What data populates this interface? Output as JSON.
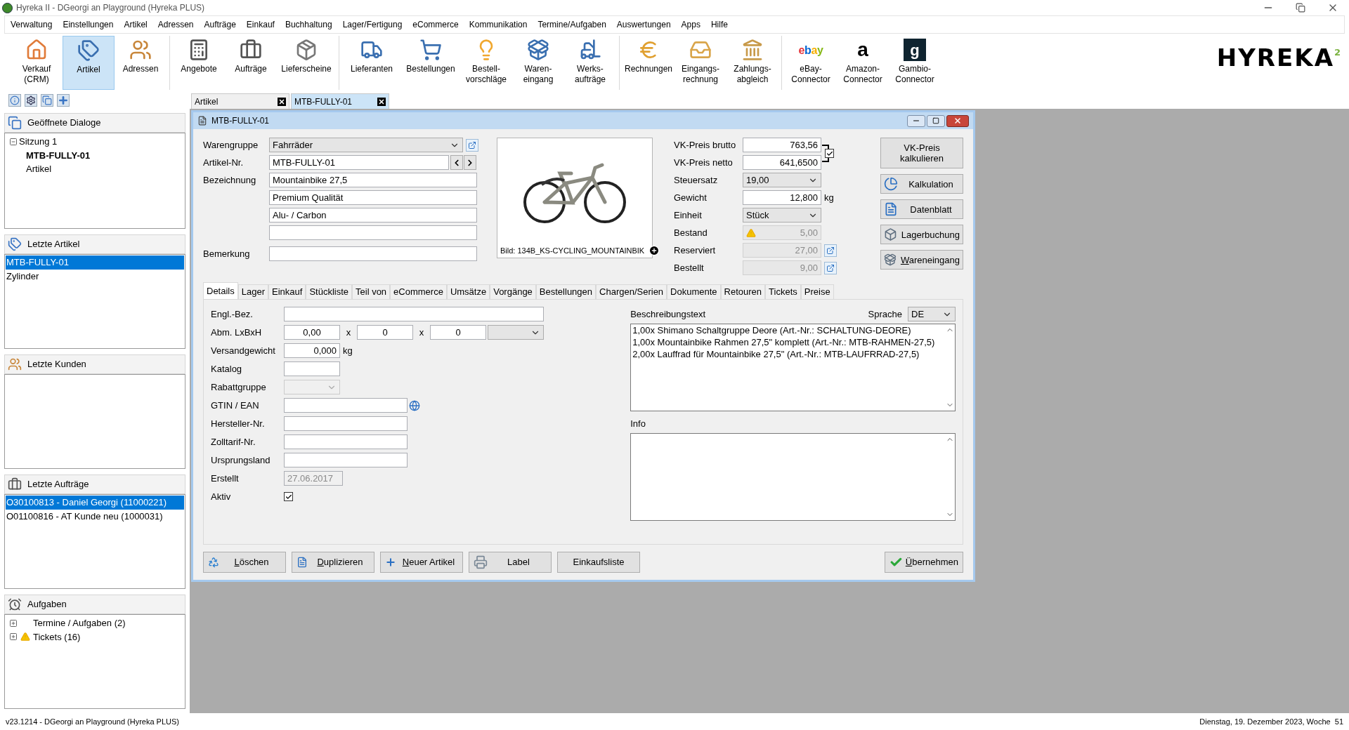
{
  "window": {
    "title": "Hyreka II - DGeorgi an Playground (Hyreka PLUS)"
  },
  "menu": [
    "Verwaltung",
    "Einstellungen",
    "Artikel",
    "Adressen",
    "Aufträge",
    "Einkauf",
    "Buchhaltung",
    "Lager/Fertigung",
    "eCommerce",
    "Kommunikation",
    "Termine/Aufgaben",
    "Auswertungen",
    "Apps",
    "Hilfe"
  ],
  "toolbar": {
    "groups": [
      {
        "items": [
          {
            "kind": "house",
            "lines": [
              "Verkauf",
              "(CRM)"
            ],
            "selected": false
          },
          {
            "kind": "tags",
            "lines": [
              "Artikel"
            ],
            "selected": true
          },
          {
            "kind": "people",
            "lines": [
              "Adressen"
            ],
            "selected": false
          }
        ]
      },
      {
        "items": [
          {
            "kind": "calculator",
            "lines": [
              "Angebote"
            ],
            "selected": false
          },
          {
            "kind": "briefcase",
            "lines": [
              "Aufträge"
            ],
            "selected": false
          },
          {
            "kind": "package",
            "lines": [
              "Lieferscheine"
            ],
            "selected": false
          }
        ]
      },
      {
        "items": [
          {
            "kind": "truck",
            "lines": [
              "Lieferanten"
            ],
            "selected": false
          },
          {
            "kind": "cart",
            "lines": [
              "Bestellungen"
            ],
            "selected": false
          },
          {
            "kind": "bulb",
            "lines": [
              "Bestell-",
              "vorschläge"
            ],
            "selected": false
          },
          {
            "kind": "box-in",
            "lines": [
              "Waren-",
              "eingang"
            ],
            "selected": false
          },
          {
            "kind": "forklift",
            "lines": [
              "Werks-",
              "aufträge"
            ],
            "selected": false
          }
        ]
      },
      {
        "items": [
          {
            "kind": "euro",
            "lines": [
              "Rechnungen"
            ],
            "selected": false
          },
          {
            "kind": "inbox",
            "lines": [
              "Eingangs-",
              "rechnung"
            ],
            "selected": false
          },
          {
            "kind": "bank",
            "lines": [
              "Zahlungs-",
              "abgleich"
            ],
            "selected": false
          }
        ]
      },
      {
        "items": [
          {
            "kind": "ebay",
            "logo": "ebay",
            "lines": [
              "eBay-",
              "Connector"
            ],
            "selected": false
          },
          {
            "kind": "amazon",
            "logo": "a",
            "lines": [
              "Amazon-",
              "Connector"
            ],
            "selected": false
          },
          {
            "kind": "gambio",
            "logo": "g",
            "lines": [
              "Gambio-",
              "Connector"
            ],
            "selected": false
          }
        ]
      }
    ]
  },
  "brand": {
    "name": "HYREKA",
    "sup": "2"
  },
  "doc_tabs": [
    {
      "label": "Artikel",
      "selected": false
    },
    {
      "label": "MTB-FULLY-01",
      "selected": true
    }
  ],
  "sidebar": {
    "open_dialogs": {
      "title": "Geöffnete Dialoge",
      "tree": [
        {
          "label": "Sitzung 1",
          "expanded": true,
          "children": [
            {
              "label": "MTB-FULLY-01",
              "selected": true
            },
            {
              "label": "Artikel",
              "selected": false
            }
          ]
        }
      ]
    },
    "recent_articles": {
      "title": "Letzte Artikel",
      "items": [
        {
          "label": "MTB-FULLY-01",
          "selected": true
        },
        {
          "label": "Zylinder",
          "selected": false
        }
      ]
    },
    "recent_customers": {
      "title": "Letzte Kunden"
    },
    "recent_orders": {
      "title": "Letzte Aufträge",
      "items": [
        {
          "label": "O30100813 - Daniel Georgi (11000221)",
          "selected": true
        },
        {
          "label": "O01100816 - AT Kunde neu (1000031)",
          "selected": false
        }
      ]
    },
    "tasks": {
      "title": "Aufgaben",
      "items": [
        {
          "label": "Termine / Aufgaben (2)",
          "expanded": false,
          "warning": false
        },
        {
          "label": "Tickets (16)",
          "expanded": false,
          "warning": true
        }
      ]
    }
  },
  "dialog": {
    "title": "MTB-FULLY-01",
    "header_fields": [
      {
        "kind": "select",
        "label": "Warengruppe",
        "value": "Fahrräder"
      },
      {
        "kind": "nav",
        "label": "Artikel-Nr.",
        "value": "MTB-FULLY-01"
      },
      {
        "kind": "text",
        "label": "Bezeichnung",
        "value": "Mountainbike 27,5"
      },
      {
        "kind": "text",
        "value": "Premium Qualität"
      },
      {
        "kind": "text",
        "value": "Alu- / Carbon"
      },
      {
        "kind": "text"
      },
      {
        "kind": "text",
        "label": "Bemerkung"
      }
    ],
    "image_caption": "Bild: 134B_KS-CYCLING_MOUNTAINBIK",
    "price_link_checked": true,
    "price_fields": [
      {
        "kind": "input",
        "label": "VK-Preis brutto",
        "value": "763,56"
      },
      {
        "kind": "input",
        "label": "VK-Preis netto",
        "value": "641,6500"
      },
      {
        "kind": "select",
        "label": "Steuersatz",
        "value": "19,00"
      },
      {
        "kind": "input",
        "label": "Gewicht",
        "value": "12,800",
        "unit": "kg"
      },
      {
        "kind": "select",
        "label": "Einheit",
        "value": "Stück"
      },
      {
        "kind": "readonly",
        "label": "Bestand",
        "value": "5,00",
        "warning": true
      },
      {
        "kind": "readonly",
        "label": "Reserviert",
        "value": "27,00",
        "link": true
      },
      {
        "kind": "readonly",
        "label": "Bestellt",
        "value": "9,00",
        "link": true
      }
    ],
    "side_buttons": [
      {
        "kind": "plain",
        "label": "VK-Preis kalkulieren"
      },
      {
        "kind": "pie",
        "label": "Kalkulation"
      },
      {
        "kind": "sheet",
        "label": "Datenblatt"
      },
      {
        "kind": "box",
        "label": "Lagerbuchung"
      },
      {
        "kind": "box-in",
        "label": "Wareneingang",
        "accelerator": true
      }
    ],
    "tabs": [
      {
        "label": "Details",
        "selected": true
      },
      {
        "label": "Lager",
        "selected": false
      },
      {
        "label": "Einkauf",
        "selected": false
      },
      {
        "label": "Stückliste",
        "selected": false
      },
      {
        "label": "Teil von",
        "selected": false
      },
      {
        "label": "eCommerce",
        "selected": false
      },
      {
        "label": "Umsätze",
        "selected": false
      },
      {
        "label": "Vorgänge",
        "selected": false
      },
      {
        "label": "Bestellungen",
        "selected": false
      },
      {
        "label": "Chargen/Serien",
        "selected": false
      },
      {
        "label": "Dokumente",
        "selected": false
      },
      {
        "label": "Retouren",
        "selected": false
      },
      {
        "label": "Tickets",
        "selected": false
      },
      {
        "label": "Preise",
        "selected": false
      }
    ],
    "details": [
      {
        "kind": "wide",
        "label": "Engl.-Bez."
      },
      {
        "kind": "dims",
        "label": "Abm. LxBxH",
        "values": [
          "0,00",
          "0",
          "0"
        ],
        "separators": [
          "x",
          "x"
        ]
      },
      {
        "kind": "number",
        "label": "Versandgewicht",
        "value": "0,000",
        "unit": "kg"
      },
      {
        "kind": "short",
        "label": "Katalog"
      },
      {
        "kind": "select",
        "label": "Rabattgruppe",
        "disabled": true
      },
      {
        "kind": "globe",
        "label": "GTIN / EAN"
      },
      {
        "kind": "medium",
        "label": "Hersteller-Nr."
      },
      {
        "kind": "medium",
        "label": "Zolltarif-Nr."
      },
      {
        "kind": "medium",
        "label": "Ursprungsland"
      },
      {
        "kind": "date",
        "label": "Erstellt",
        "value": "27.06.2017",
        "disabled": true
      },
      {
        "kind": "check",
        "label": "Aktiv",
        "checked": true
      }
    ],
    "description": {
      "label": "Beschreibungstext",
      "language_label": "Sprache",
      "language": "DE",
      "lines": [
        "1,00x Shimano Schaltgruppe Deore (Art.-Nr.: SCHALTUNG-DEORE)",
        "1,00x Mountainbike Rahmen 27,5\" komplett (Art.-Nr.: MTB-RAHMEN-27,5)",
        "2,00x Lauffrad für Mountainbike 27,5\" (Art.-Nr.: MTB-LAUFRRAD-27,5)"
      ]
    },
    "info": {
      "label": "Info"
    },
    "buttons": [
      {
        "kind": "recycle",
        "label": "Löschen",
        "accelerator": true
      },
      {
        "kind": "doc",
        "label": "Duplizieren",
        "accelerator": true
      },
      {
        "kind": "plus",
        "label": "Neuer Artikel",
        "accelerator": true
      },
      {
        "kind": "printer",
        "label": "Label",
        "accelerator": false
      },
      {
        "kind": "none",
        "label": "Einkaufsliste",
        "accelerator": false
      },
      {
        "kind": "check",
        "label": "Übernehmen",
        "accelerator": true
      }
    ]
  },
  "status_bar": {
    "left": "v23.1214 - DGeorgi an Playground (Hyreka PLUS)",
    "right": "Dienstag, 19. Dezember 2023, Woche  51"
  }
}
